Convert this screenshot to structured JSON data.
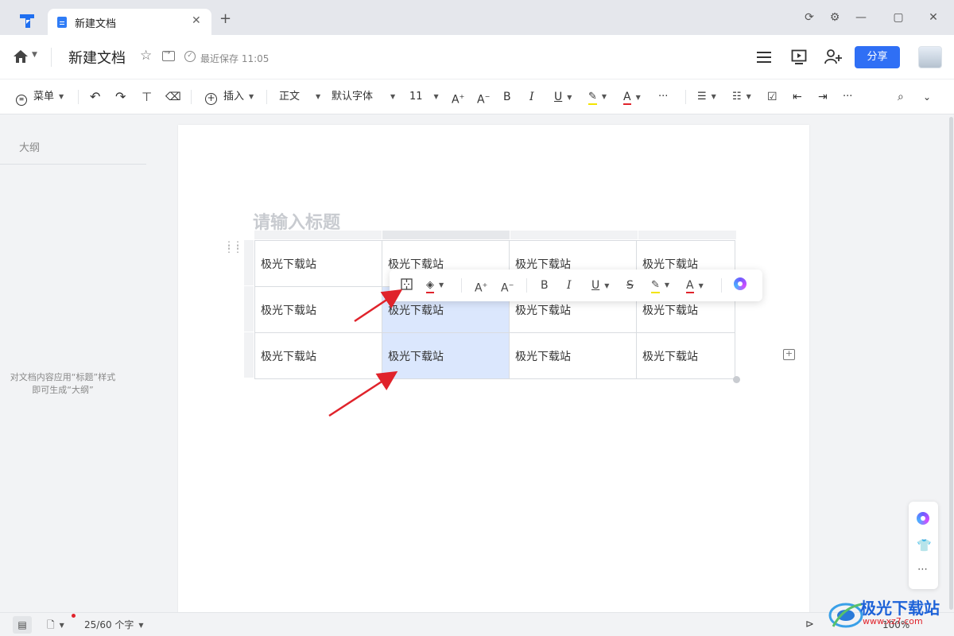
{
  "tabs": [
    {
      "label": "新建文档"
    }
  ],
  "colors": {
    "accent": "#2f6ff5",
    "selection": "#dbe7fd",
    "arrow": "#e0232b",
    "highlight": "#f3e400",
    "font_color": "#e0232b"
  },
  "doc": {
    "title": "新建文档",
    "saved_status": "最近保存 11:05"
  },
  "header_actions": {
    "share_label": "分享"
  },
  "toolbar": {
    "menu_label": "菜单",
    "insert_label": "插入",
    "paragraph_style": "正文",
    "font_family": "默认字体",
    "font_size": "11",
    "bold": "B",
    "italic": "I",
    "underline": "U",
    "font_color": "A",
    "more": "···"
  },
  "sidebar": {
    "outline_title": "大纲",
    "outline_hint_line1": "对文档内容应用“标题”样式",
    "outline_hint_line2": "即可生成“大纲”"
  },
  "editor": {
    "title_placeholder": "请输入标题"
  },
  "table": {
    "rows": [
      [
        "极光下载站",
        "极光下载站",
        "极光下载站",
        "极光下载站"
      ],
      [
        "极光下载站",
        "极光下载站",
        "极光下载站",
        "极光下载站"
      ],
      [
        "极光下载站",
        "极光下载站",
        "极光下载站",
        "极光下载站"
      ]
    ],
    "selected_cells": [
      [
        1,
        1
      ],
      [
        2,
        1
      ]
    ]
  },
  "float_toolbar": {
    "bold": "B",
    "italic": "I",
    "underline": "U",
    "strike": "S",
    "font_color": "A"
  },
  "statusbar": {
    "word_count": "25/60 个字",
    "zoom": "100%"
  },
  "watermark": {
    "name": "极光下载站",
    "url": "www.xz7.com"
  }
}
